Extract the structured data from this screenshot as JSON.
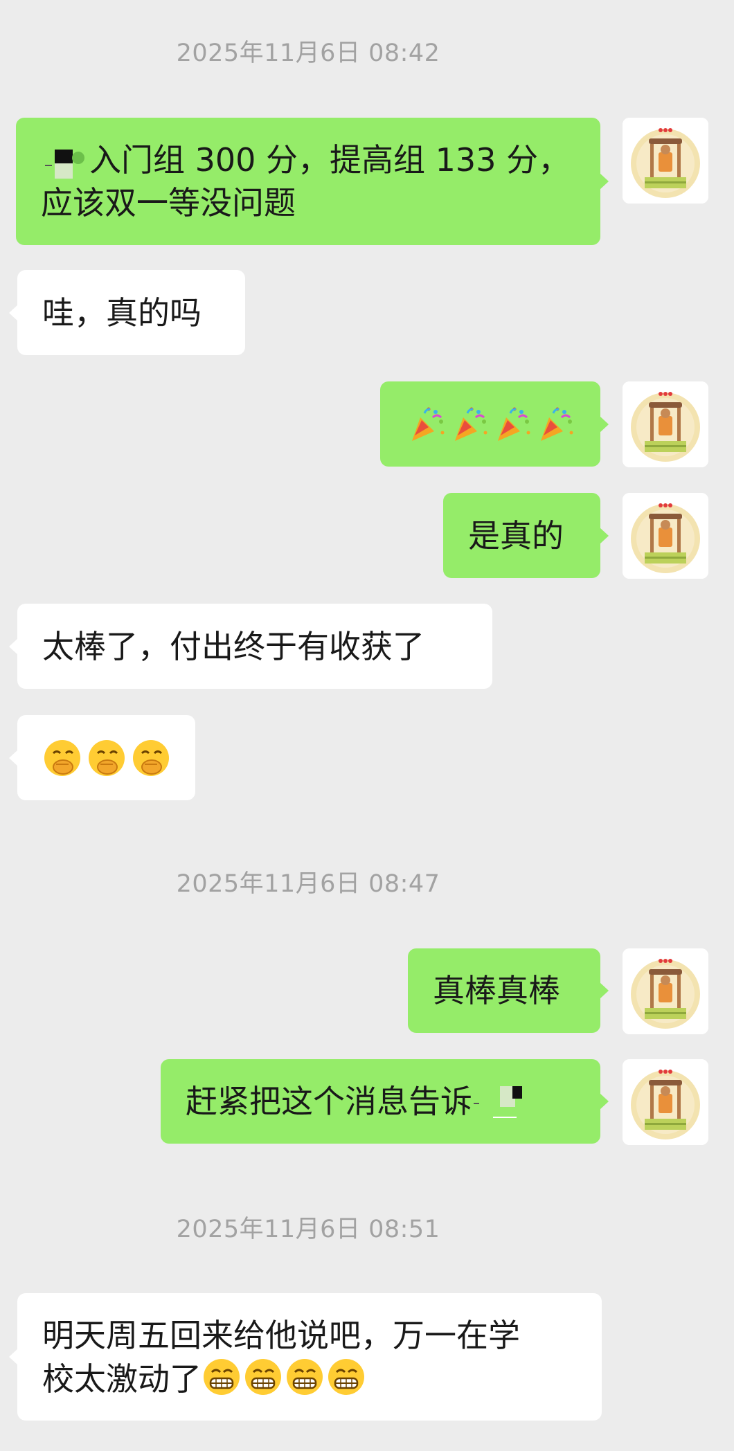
{
  "chat": {
    "timestamps": [
      "2025年11月6日 08:42",
      "2025年11月6日 08:47",
      "2025年11月6日 08:51"
    ],
    "messages": [
      {
        "side": "out",
        "text_line1": "入门组 300 分，提高组 133 分，",
        "text_line2": "应该双一等没问题"
      },
      {
        "side": "in",
        "text": "哇，真的吗"
      },
      {
        "side": "out",
        "emoji": "party-popper-icon",
        "emoji_count": 4
      },
      {
        "side": "out",
        "text": "是真的"
      },
      {
        "side": "in",
        "text": "太棒了，付出终于有收获了"
      },
      {
        "side": "in",
        "emoji": "hand-over-mouth-icon",
        "emoji_count": 3
      },
      {
        "side": "out",
        "text": "真棒真棒"
      },
      {
        "side": "out",
        "text": "赶紧把这个消息告诉"
      },
      {
        "side": "in",
        "text_line1": "明天周五回来给他说吧，万一在学",
        "text_line2": "校太激动了",
        "emoji": "grin-icon",
        "emoji_count": 4
      }
    ]
  },
  "colors": {
    "background": "#ececec",
    "outgoing_bubble": "#95ec69",
    "incoming_bubble": "#ffffff",
    "timestamp_text": "#a2a2a2"
  }
}
